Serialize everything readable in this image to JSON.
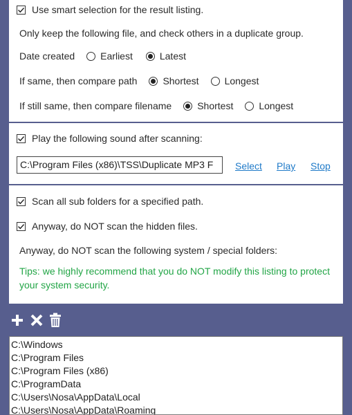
{
  "result_listing": {
    "smart_selection_label": "Use smart selection for the result listing.",
    "smart_selection_checked": true,
    "description": "Only keep the following file, and check others in a duplicate group.",
    "date_created_label": "Date created",
    "date_options": [
      "Earliest",
      "Latest"
    ],
    "date_selected": "Latest",
    "path_label": "If same, then compare path",
    "path_options": [
      "Shortest",
      "Longest"
    ],
    "path_selected": "Shortest",
    "filename_label": "If still same, then compare filename",
    "filename_options": [
      "Shortest",
      "Longest"
    ],
    "filename_selected": "Shortest"
  },
  "sound": {
    "play_sound_label": "Play the following sound after scanning:",
    "play_sound_checked": true,
    "sound_path_value": "C:\\Program Files (x86)\\TSS\\Duplicate MP3 F",
    "select_label": "Select",
    "play_label": "Play",
    "stop_label": "Stop"
  },
  "scan_options": {
    "scan_subfolders_label": "Scan all sub folders for a specified path.",
    "scan_subfolders_checked": true,
    "skip_hidden_label": "Anyway, do NOT scan the hidden files.",
    "skip_hidden_checked": true,
    "system_folders_label": "Anyway, do NOT scan the following system / special folders:",
    "tips": "Tips: we highly recommend that you do NOT modify this listing to protect your system security."
  },
  "toolbar": {
    "icons": [
      "add-icon",
      "delete-icon",
      "trash-icon"
    ]
  },
  "excluded_folders": [
    "C:\\Windows",
    "C:\\Program Files",
    "C:\\Program Files (x86)",
    "C:\\ProgramData",
    "C:\\Users\\Nosa\\AppData\\Local",
    "C:\\Users\\Nosa\\AppData\\Roaming"
  ],
  "colors": {
    "background": "#575e8e",
    "tips": "#22a546",
    "link": "#1f7ac8"
  }
}
